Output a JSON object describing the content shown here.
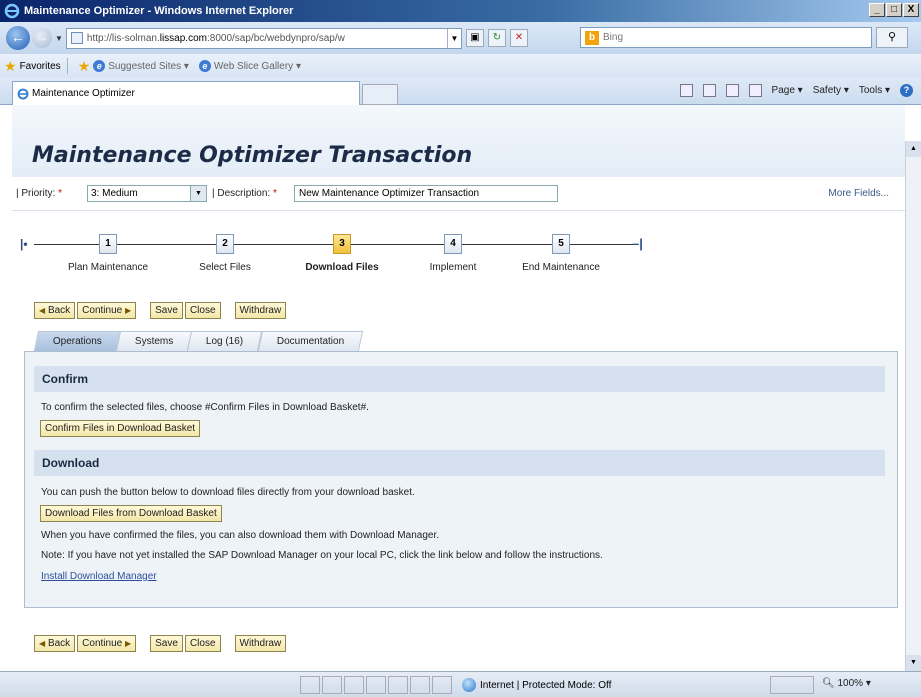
{
  "window": {
    "title": "Maintenance Optimizer - Windows Internet Explorer",
    "min": "_",
    "max": "□",
    "close": "X"
  },
  "address_bar": {
    "url_prefix": "http://lis-solman.",
    "url_domain": "lissap.com",
    "url_suffix": ":8000/sap/bc/webdynpro/sap/w",
    "search_placeholder": "Bing"
  },
  "favorites_bar": {
    "favorites_label": "Favorites",
    "suggested_sites": "Suggested Sites ▾",
    "web_slice_gallery": "Web Slice Gallery ▾"
  },
  "browser_tab": {
    "label": "Maintenance Optimizer"
  },
  "command_bar": {
    "page": "Page ▾",
    "safety": "Safety ▾",
    "tools": "Tools ▾"
  },
  "app": {
    "title": "Maintenance Optimizer Transaction",
    "priority_label": "Priority:",
    "priority_value": "3: Medium",
    "description_label": "Description:",
    "description_value": "New Maintenance Optimizer Transaction",
    "required_marker": "*",
    "more_fields": "More Fields..."
  },
  "roadmap": {
    "steps": [
      {
        "number": "1",
        "label": "Plan Maintenance",
        "active": false
      },
      {
        "number": "2",
        "label": "Select Files",
        "active": false
      },
      {
        "number": "3",
        "label": "Download Files",
        "active": true
      },
      {
        "number": "4",
        "label": "Implement",
        "active": false
      },
      {
        "number": "5",
        "label": "End Maintenance",
        "active": false
      }
    ]
  },
  "toolbar": {
    "back": "Back",
    "continue": "Continue",
    "save": "Save",
    "close": "Close",
    "withdraw": "Withdraw"
  },
  "tabs": [
    {
      "label": "Operations",
      "active": true
    },
    {
      "label": "Systems",
      "active": false
    },
    {
      "label": "Log (16)",
      "active": false
    },
    {
      "label": "Documentation",
      "active": false
    }
  ],
  "confirm_section": {
    "header": "Confirm",
    "text": "To confirm the selected files, choose #Confirm Files in Download Basket#.",
    "button": "Confirm Files in Download Basket"
  },
  "download_section": {
    "header": "Download",
    "text1": "You can push the button below to download files directly from your download basket.",
    "button": "Download Files from Download Basket",
    "text2": "When you have confirmed the files, you can also download them with Download Manager.",
    "text3": "Note: If you have not yet installed the SAP Download Manager on your local PC, click the link below and follow the instructions.",
    "link": "Install Download Manager"
  },
  "status_bar": {
    "zone": "Internet | Protected Mode: Off",
    "zoom": "100%"
  }
}
